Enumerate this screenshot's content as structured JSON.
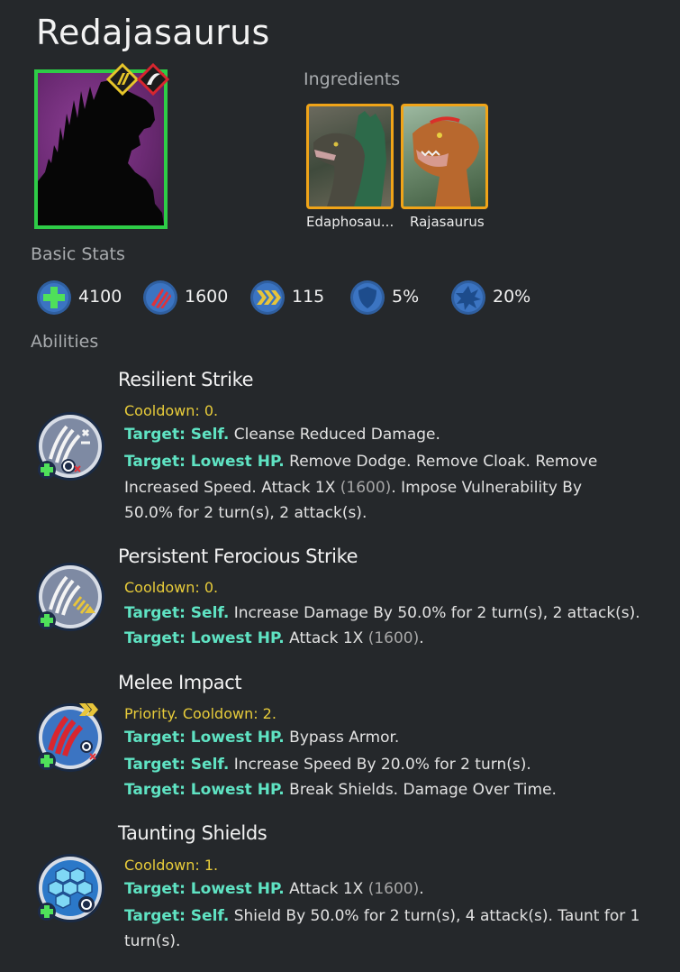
{
  "creature": {
    "name": "Redajasaurus"
  },
  "ingredients": {
    "label": "Ingredients",
    "items": [
      {
        "name": "Edaphosau..."
      },
      {
        "name": "Rajasaurus"
      }
    ]
  },
  "stats": {
    "label": "Basic Stats",
    "items": [
      {
        "icon": "health-icon",
        "value": "4100"
      },
      {
        "icon": "damage-icon",
        "value": "1600"
      },
      {
        "icon": "speed-icon",
        "value": "115"
      },
      {
        "icon": "armor-icon",
        "value": "5%"
      },
      {
        "icon": "critical-icon",
        "value": "20%"
      }
    ]
  },
  "abilities": {
    "label": "Abilities",
    "items": [
      {
        "name": "Resilient Strike",
        "cooldown": "Cooldown: 0.",
        "lines": [
          {
            "target": "Target: Self.",
            "text": "Cleanse Reduced Damage."
          },
          {
            "target": "Target: Lowest HP.",
            "text": "Remove Dodge. Remove Cloak. Remove"
          },
          {
            "text_before": "Increased Speed. Attack 1X ",
            "paren": "(1600)",
            "text_after": ". Impose Vulnerability By"
          },
          {
            "text": "50.0% for 2 turn(s), 2 attack(s)."
          }
        ]
      },
      {
        "name": "Persistent Ferocious Strike",
        "cooldown": "Cooldown: 0.",
        "lines": [
          {
            "target": "Target: Self.",
            "text": "Increase Damage By 50.0% for 2 turn(s), 2 attack(s)."
          },
          {
            "target": "Target: Lowest HP.",
            "text_before": "Attack 1X ",
            "paren": "(1600)",
            "text_after": "."
          }
        ]
      },
      {
        "name": "Melee Impact",
        "cooldown": "Priority. Cooldown: 2.",
        "lines": [
          {
            "target": "Target: Lowest HP.",
            "text": "Bypass Armor."
          },
          {
            "target": "Target: Self.",
            "text": "Increase Speed By 20.0% for 2 turn(s)."
          },
          {
            "target": "Target: Lowest HP.",
            "text": "Break Shields. Damage Over Time."
          }
        ]
      },
      {
        "name": "Taunting Shields",
        "cooldown": "Cooldown: 1.",
        "lines": [
          {
            "target": "Target: Lowest HP.",
            "text_before": "Attack 1X ",
            "paren": "(1600)",
            "text_after": "."
          },
          {
            "target": "Target: Self.",
            "text": "Shield By 50.0% for 2 turn(s), 4 attack(s). Taunt for 1"
          },
          {
            "text": "turn(s)."
          }
        ]
      }
    ]
  },
  "colors": {
    "background": "#25282b",
    "target": "#5fe3c3",
    "cooldown": "#e8cc3a",
    "rarity_border": "#2ecc47",
    "ingredient_border": "#f0a418"
  }
}
